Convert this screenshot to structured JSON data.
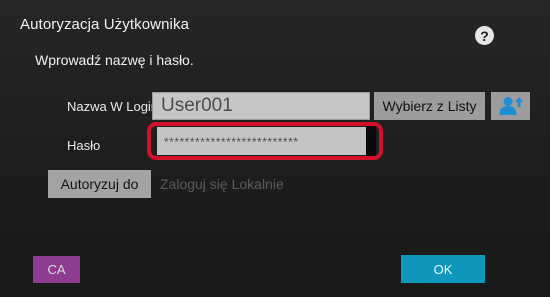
{
  "dialog": {
    "title": "Autoryzacja Użytkownika",
    "subtitle": "Wprowadź nazwę i hasło.",
    "help_symbol": "?"
  },
  "form": {
    "login_label": "Nazwa W Login",
    "login_value": "User001",
    "password_label": "Hasło",
    "password_value": "**************************",
    "select_from_list_label": "Wybierz z Listy",
    "authorize_to_label": "Autoryzuj do",
    "authorize_target": "Zaloguj się Lokalnie"
  },
  "footer": {
    "ca_label": "CA",
    "ok_label": "OK"
  },
  "colors": {
    "highlight": "#d1102a",
    "ok_button": "#0f97bc",
    "ca_button": "#8f3b8f",
    "user_icon": "#1e8ed2"
  },
  "icons": {
    "help": "help-icon",
    "user_select": "user-up-arrow-icon"
  }
}
